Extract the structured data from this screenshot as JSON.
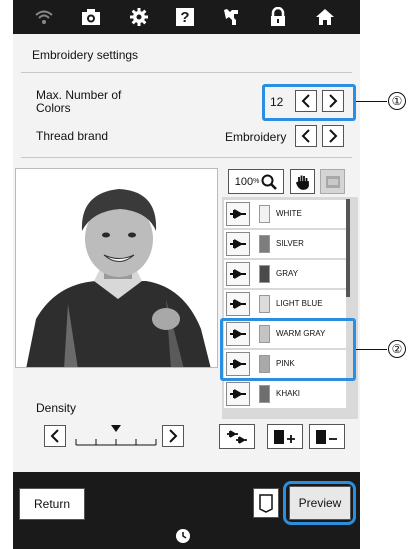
{
  "header": {
    "icons": [
      "wifi-icon",
      "camera-icon",
      "gear-icon",
      "help-icon",
      "sewing-machine-icon",
      "lock-icon",
      "home-icon"
    ],
    "help_glyph": "?"
  },
  "panel": {
    "title": "Embroidery settings"
  },
  "max_colors": {
    "label": "Max. Number of Colors",
    "value": "12"
  },
  "thread_brand": {
    "label": "Thread brand",
    "value": "Embroidery"
  },
  "zoom": {
    "value": "100",
    "unit": "%"
  },
  "threads": [
    {
      "name": "WHITE",
      "color": "#f2f2f2"
    },
    {
      "name": "SILVER",
      "color": "#7d7d7d"
    },
    {
      "name": "GRAY",
      "color": "#4a4a4a"
    },
    {
      "name": "LIGHT BLUE",
      "color": "#dcdcdc"
    },
    {
      "name": "WARM GRAY",
      "color": "#c4c4c4"
    },
    {
      "name": "PINK",
      "color": "#a9a9a9"
    },
    {
      "name": "KHAKI",
      "color": "#6e6e6e"
    }
  ],
  "density": {
    "label": "Density",
    "level_fraction": 0.5
  },
  "callouts": {
    "one": "①",
    "two": "②"
  },
  "footer": {
    "return_label": "Return",
    "preview_label": "Preview"
  },
  "colors": {
    "callout": "#2a8fe0",
    "topbar": "#1a1a1a",
    "panel": "#f3f3f3"
  }
}
